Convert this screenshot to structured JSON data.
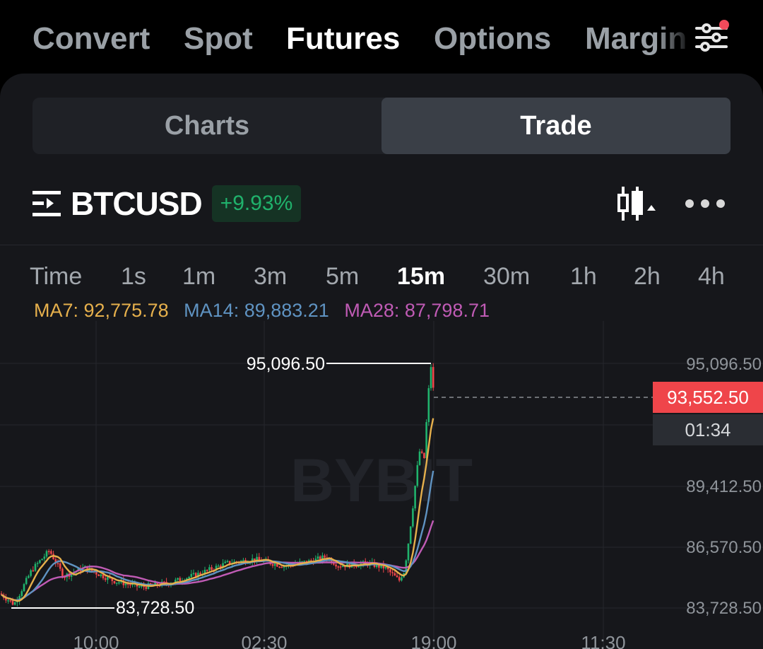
{
  "top_tabs": [
    {
      "label": "Convert",
      "active": false
    },
    {
      "label": "Spot",
      "active": false
    },
    {
      "label": "Futures",
      "active": true
    },
    {
      "label": "Options",
      "active": false
    },
    {
      "label": "Margin",
      "active": false
    }
  ],
  "segment": {
    "charts_label": "Charts",
    "trade_label": "Trade",
    "active": "Trade"
  },
  "symbol": {
    "name": "BTCUSD",
    "change": "+9.93%"
  },
  "intervals": [
    "Time",
    "1s",
    "1m",
    "3m",
    "5m",
    "15m",
    "30m",
    "1h",
    "2h",
    "4h"
  ],
  "active_interval": "15m",
  "moving_averages": {
    "ma7": {
      "label": "MA7: 92,775.78",
      "color": "#e6b04c"
    },
    "ma14": {
      "label": "MA14: 89,883.21",
      "color": "#5f93c2"
    },
    "ma28": {
      "label": "MA28: 87,798.71",
      "color": "#c05bb5"
    }
  },
  "watermark": "BYBIT",
  "chart_data": {
    "type": "candlestick",
    "y_ticks": [
      "95,096.50",
      "89,412.50",
      "86,570.50",
      "83,728.50"
    ],
    "x_ticks": [
      "10:00",
      "02:30",
      "19:00",
      "11:30"
    ],
    "high_label": "95,096.50",
    "low_label": "83,728.50",
    "current_price": "93,552.50",
    "countdown": "01:34",
    "ylim": [
      83728.5,
      95096.5
    ],
    "colors": {
      "up": "#20b26c",
      "down": "#ef454a",
      "price_tag": "#ef454a"
    }
  }
}
